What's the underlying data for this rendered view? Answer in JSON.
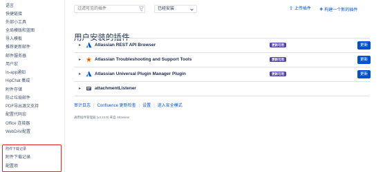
{
  "sidebar": {
    "items": [
      "语言",
      "快捷链接",
      "外部小工具",
      "全局模版和蓝图",
      "导入模板",
      "推荐更新邮件",
      "邮件服务器",
      "用户宏",
      "In-app通知",
      "HipChat 集成",
      "附件存储",
      "防止垃圾邮件",
      "PDF导出源文支持",
      "配置代码宏",
      "Office 连接器",
      "WebDAV配置"
    ],
    "highlight_items": [
      "附件下载记录",
      "附件下载记录",
      "配置项"
    ]
  },
  "toolbar": {
    "filter_placeholder": "过滤可见的插件",
    "select_value": "已经安装",
    "upload_label": "上传插件",
    "build_label": "构建一个新的插件"
  },
  "main": {
    "title": "用户安装的插件",
    "plugins": [
      {
        "name": "Atlassian REST API Browser",
        "badge": "更新可用",
        "button": "更新",
        "icon": "atlassian-logo-icon"
      },
      {
        "name": "Atlassian Troubleshooting and Support Tools",
        "badge": "更新可用",
        "button": "更新",
        "icon": "support-tools-icon"
      },
      {
        "name": "Atlassian Universal Plugin Manager Plugin",
        "badge": "更新可用",
        "button": "更新",
        "icon": "atlassian-logo-icon"
      },
      {
        "name": "attachmentListener",
        "icon": "plugin-icon"
      }
    ],
    "links": [
      "审计日志",
      "Confluence 更新检查",
      "设置",
      "进入安全模式"
    ],
    "footer": "通用插件管理器 (v2.22.9) 来自 Atlassian"
  },
  "colors": {
    "accent": "#0052cc",
    "badge": "#5243aa",
    "highlight_border": "#e02424"
  }
}
